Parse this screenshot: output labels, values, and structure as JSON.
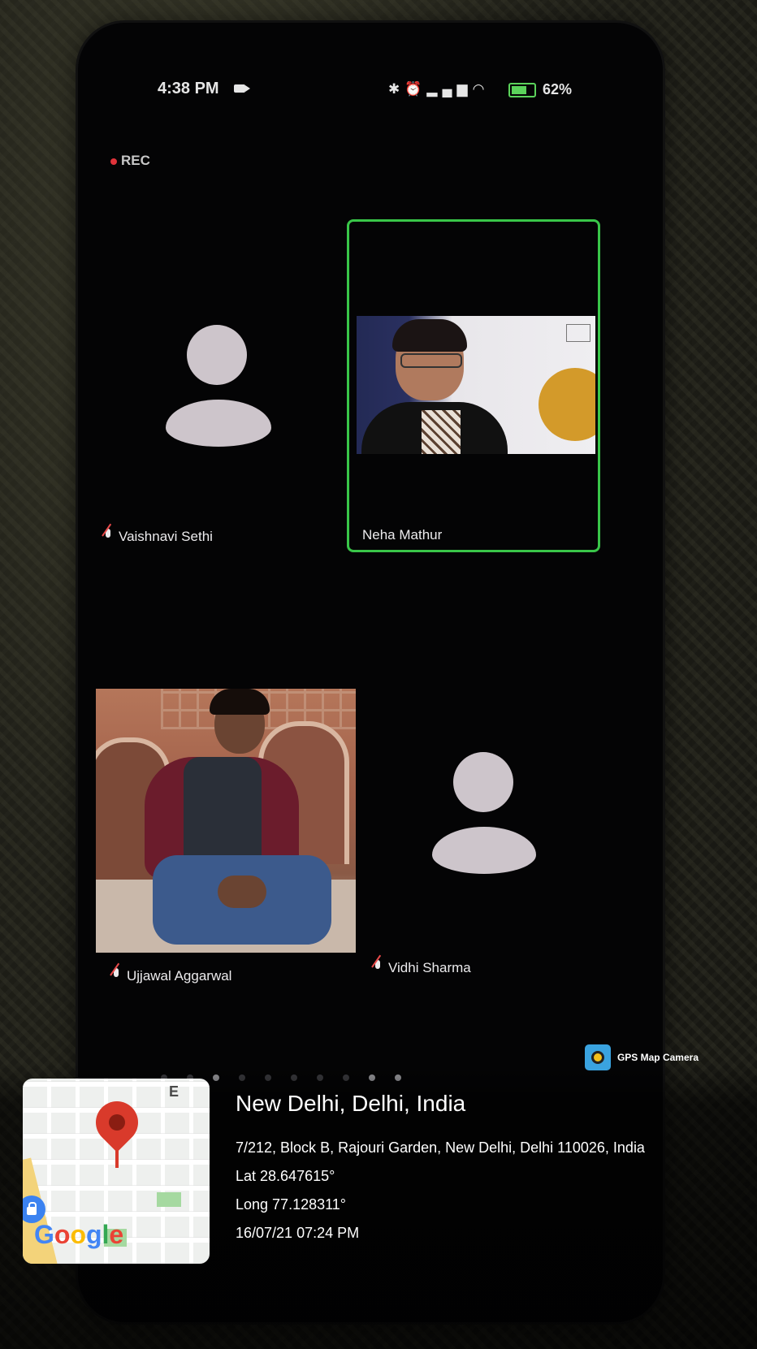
{
  "status_bar": {
    "time": "4:38 PM",
    "battery_percent": "62%"
  },
  "meeting": {
    "recording_label": "REC",
    "participants": [
      {
        "name": "Vaishnavi Sethi",
        "muted": true,
        "video": false
      },
      {
        "name": "Neha Mathur",
        "muted": false,
        "video": true,
        "active_speaker": true
      },
      {
        "name": "Ujjawal Aggarwal",
        "muted": true,
        "video": true
      },
      {
        "name": "Vidhi Sharma",
        "muted": true,
        "video": false
      }
    ],
    "active_color": "#39c649"
  },
  "gps_overlay": {
    "app_label": "GPS Map Camera",
    "map_compass": "E",
    "map_logo": "Google",
    "location_title": "New Delhi, Delhi, India",
    "address": "7/212, Block B, Rajouri Garden, New Delhi, Delhi 110026, India",
    "latitude": "Lat 28.647615°",
    "longitude": "Long 77.128311°",
    "datetime": "16/07/21 07:24 PM"
  }
}
